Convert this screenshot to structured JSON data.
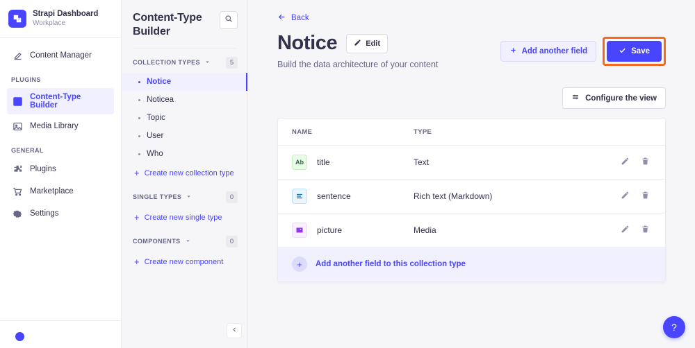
{
  "brand": {
    "title": "Strapi Dashboard",
    "subtitle": "Workplace",
    "logo_icon": "strapi-cube-icon",
    "color": "#4945ff"
  },
  "mainnav": {
    "top_items": [
      {
        "label": "Content Manager",
        "icon": "pencil-square-icon",
        "active": false
      }
    ],
    "sections": [
      {
        "label": "PLUGINS",
        "items": [
          {
            "label": "Content-Type Builder",
            "icon": "layout-grid-icon",
            "active": true
          },
          {
            "label": "Media Library",
            "icon": "image-icon",
            "active": false
          }
        ]
      },
      {
        "label": "GENERAL",
        "items": [
          {
            "label": "Plugins",
            "icon": "puzzle-icon",
            "active": false
          },
          {
            "label": "Marketplace",
            "icon": "shopping-cart-icon",
            "active": false
          },
          {
            "label": "Settings",
            "icon": "gear-icon",
            "active": false
          }
        ]
      }
    ]
  },
  "subnav": {
    "title": "Content-Type Builder",
    "search_icon": "search-icon",
    "collapse_icon": "chevron-left-icon",
    "groups": [
      {
        "label": "COLLECTION TYPES",
        "count": "5",
        "items": [
          {
            "label": "Notice",
            "active": true
          },
          {
            "label": "Noticea",
            "active": false
          },
          {
            "label": "Topic",
            "active": false
          },
          {
            "label": "User",
            "active": false
          },
          {
            "label": "Who",
            "active": false
          }
        ],
        "create_label": "Create new collection type"
      },
      {
        "label": "SINGLE TYPES",
        "count": "0",
        "items": [],
        "create_label": "Create new single type"
      },
      {
        "label": "COMPONENTS",
        "count": "0",
        "items": [],
        "create_label": "Create new component"
      }
    ]
  },
  "content": {
    "back_label": "Back",
    "back_icon": "arrow-left-icon",
    "page_title": "Notice",
    "edit_label": "Edit",
    "edit_icon": "pencil-icon",
    "subtitle": "Build the data architecture of your content",
    "add_field_label": "Add another field",
    "add_field_icon": "plus-icon",
    "save_label": "Save",
    "save_icon": "check-icon",
    "save_highlight_color": "#f36b21",
    "configure_label": "Configure the view",
    "configure_icon": "sliders-icon",
    "table": {
      "headers": [
        "NAME",
        "TYPE"
      ],
      "rows": [
        {
          "name": "title",
          "type": "Text",
          "icon": "text-field-icon",
          "icon_label": "Ab",
          "icon_style": "ico-text"
        },
        {
          "name": "sentence",
          "type": "Rich text (Markdown)",
          "icon": "rich-text-icon",
          "icon_label": "",
          "icon_style": "ico-rich"
        },
        {
          "name": "picture",
          "type": "Media",
          "icon": "media-image-icon",
          "icon_label": "",
          "icon_style": "ico-media"
        }
      ],
      "row_actions": {
        "edit_icon": "pencil-icon",
        "delete_icon": "trash-icon"
      }
    },
    "add_another_field_row": {
      "label": "Add another field to this collection type",
      "icon": "plus-circle-icon"
    },
    "help_label": "?"
  }
}
